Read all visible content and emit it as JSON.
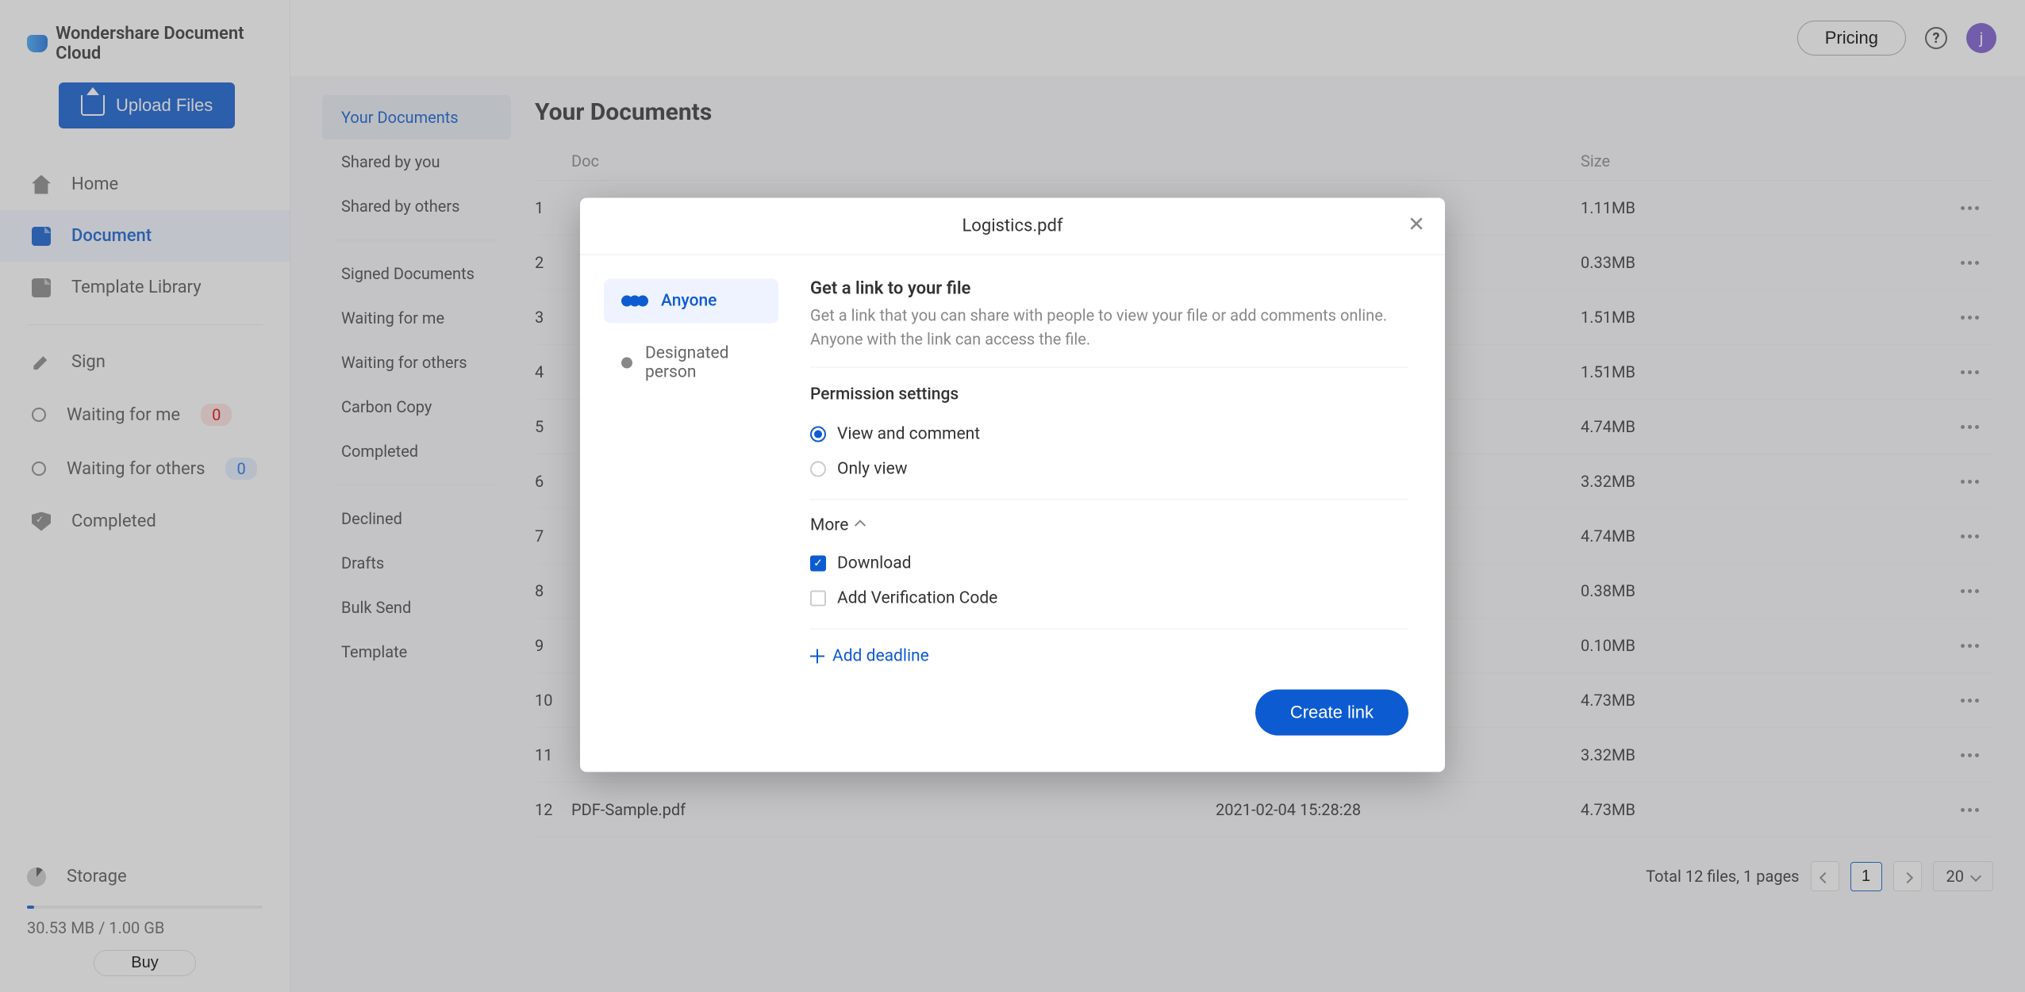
{
  "brand": "Wondershare Document Cloud",
  "upload_label": "Upload Files",
  "nav": {
    "home": "Home",
    "document": "Document",
    "template_library": "Template Library",
    "sign": "Sign",
    "waiting_me": "Waiting for me",
    "waiting_me_count": "0",
    "waiting_others": "Waiting for others",
    "waiting_others_count": "0",
    "completed": "Completed"
  },
  "storage": {
    "title": "Storage",
    "text": "30.53 MB / 1.00 GB",
    "buy": "Buy"
  },
  "topbar": {
    "pricing": "Pricing",
    "avatar_letter": "j"
  },
  "subnav": {
    "your_docs": "Your Documents",
    "shared_by_you": "Shared by you",
    "shared_by_others": "Shared by others",
    "signed_docs": "Signed Documents",
    "waiting_me": "Waiting for me",
    "waiting_others": "Waiting for others",
    "carbon_copy": "Carbon Copy",
    "completed": "Completed",
    "declined": "Declined",
    "drafts": "Drafts",
    "bulk_send": "Bulk Send",
    "template": "Template"
  },
  "content": {
    "heading": "Your Documents",
    "cols": {
      "doc": "Doc",
      "size": "Size"
    },
    "rows": [
      {
        "i": "1",
        "size": "1.11MB"
      },
      {
        "i": "2",
        "size": "0.33MB"
      },
      {
        "i": "3",
        "size": "1.51MB"
      },
      {
        "i": "4",
        "size": "1.51MB"
      },
      {
        "i": "5",
        "size": "4.74MB"
      },
      {
        "i": "6",
        "size": "3.32MB"
      },
      {
        "i": "7",
        "size": "4.74MB"
      },
      {
        "i": "8",
        "size": "0.38MB"
      },
      {
        "i": "9",
        "size": "0.10MB"
      },
      {
        "i": "10",
        "size": "4.73MB"
      },
      {
        "i": "11",
        "size": "3.32MB"
      },
      {
        "i": "12",
        "name": "PDF-Sample.pdf",
        "date": "2021-02-04 15:28:28",
        "size": "4.73MB"
      }
    ],
    "pager": {
      "summary": "Total 12 files, 1 pages",
      "page": "1",
      "pagesize": "20"
    }
  },
  "modal": {
    "title": "Logistics.pdf",
    "tab_anyone": "Anyone",
    "tab_designated": "Designated person",
    "link_title": "Get a link to your file",
    "link_desc": "Get a link that you can share with people to view your file or add comments online. Anyone with the link can access the file.",
    "perm_title": "Permission settings",
    "opt_view_comment": "View and comment",
    "opt_only_view": "Only view",
    "more_label": "More",
    "download_label": "Download",
    "verification_label": "Add Verification Code",
    "add_deadline": "Add deadline",
    "create_link": "Create link"
  }
}
